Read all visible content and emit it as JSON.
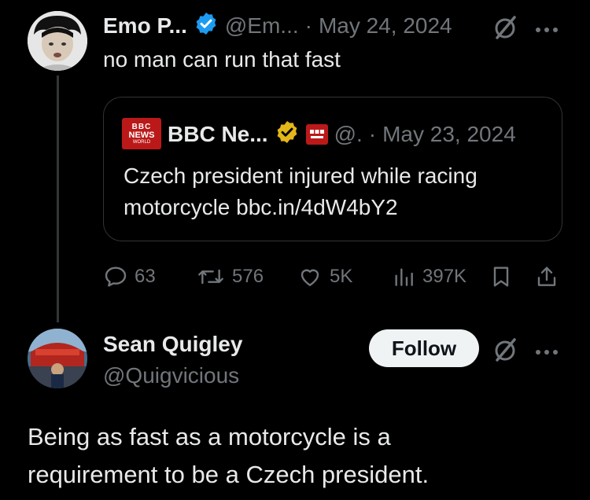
{
  "quoting_tweet": {
    "author_name": "Emo P...",
    "handle": "@Em...",
    "separator": "·",
    "date": "May 24, 2024",
    "text": "no man can run that fast"
  },
  "quoted_tweet": {
    "logo_text_top": "BBC",
    "logo_text_mid": "NEWS",
    "logo_text_bottom": "WORLD",
    "author_name": "BBC Ne...",
    "handle": "@.",
    "separator": "·",
    "date": "May 23, 2024",
    "text_line1": "Czech president injured while racing",
    "text_line2": "motorcycle bbc.in/4dW4bY2"
  },
  "actions": {
    "replies": "63",
    "reposts": "576",
    "likes": "5K",
    "views": "397K"
  },
  "reply": {
    "author_name": "Sean Quigley",
    "handle": "@Quigvicious",
    "follow_label": "Follow",
    "text_line1": "Being as fast as a motorcycle is a",
    "text_line2": "requirement to be a Czech president."
  },
  "colors": {
    "background": "#000000",
    "text": "#e7e9ea",
    "muted": "#71767b",
    "verified_blue": "#1d9bf0",
    "verified_gold": "#e2b719",
    "bbc_red": "#bb1919"
  }
}
